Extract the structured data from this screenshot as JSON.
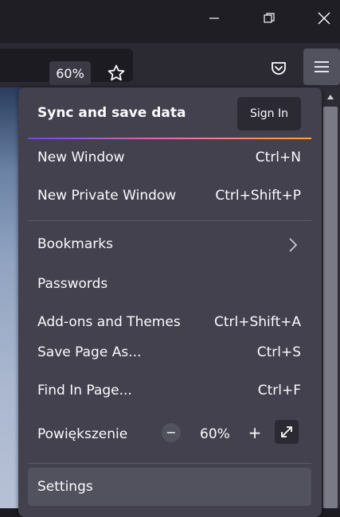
{
  "navbar": {
    "zoom_badge": "60%"
  },
  "menu": {
    "sync_title": "Sync and save data",
    "signin_label": "Sign In",
    "items": [
      {
        "label": "New Window",
        "shortcut": "Ctrl+N"
      },
      {
        "label": "New Private Window",
        "shortcut": "Ctrl+Shift+P"
      },
      {
        "label": "Bookmarks",
        "shortcut": ""
      },
      {
        "label": "Passwords",
        "shortcut": ""
      },
      {
        "label": "Add-ons and Themes",
        "shortcut": "Ctrl+Shift+A"
      },
      {
        "label": "Save Page As...",
        "shortcut": "Ctrl+S"
      },
      {
        "label": "Find In Page...",
        "shortcut": "Ctrl+F"
      }
    ],
    "zoom": {
      "label": "Powiększenie",
      "minus": "−",
      "value": "60%",
      "plus": "+"
    },
    "settings_label": "Settings"
  },
  "icons": {
    "minimize": "minimize-icon",
    "restore": "restore-icon",
    "close": "close-icon",
    "bookmark": "star-icon",
    "pocket": "pocket-icon",
    "menu": "hamburger-menu-icon",
    "bookmarks_submenu": "chevron-right-icon",
    "fullscreen": "fullscreen-icon",
    "scroll_up": "scroll-up-arrow-icon"
  },
  "colors": {
    "panel_bg": "#42414d",
    "accent_gradient": [
      "#7542e5",
      "#e46fb0",
      "#ffa436"
    ]
  }
}
